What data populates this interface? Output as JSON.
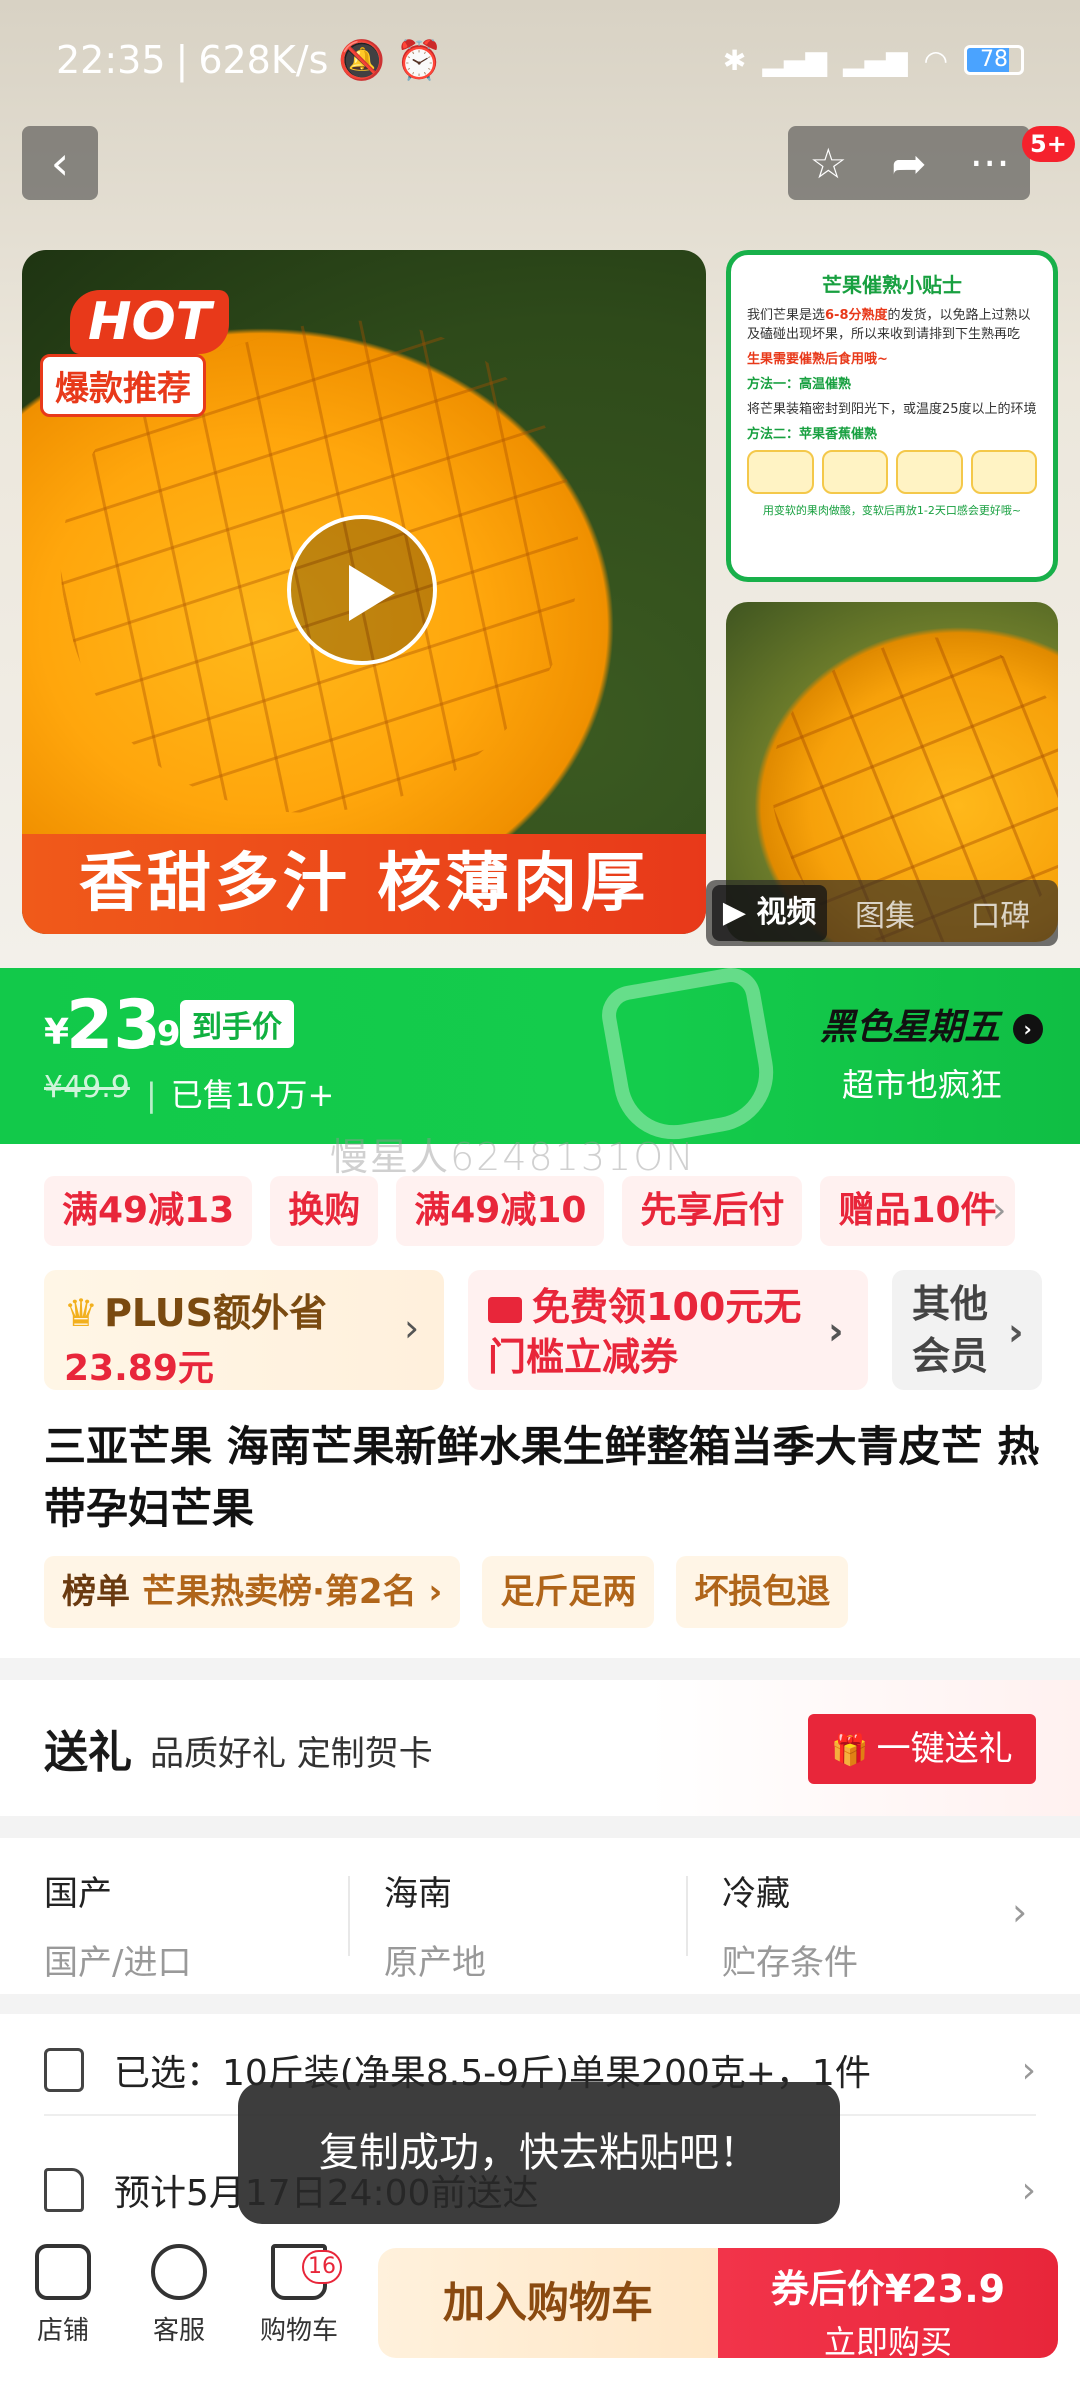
{
  "status_bar": {
    "time": "22:35",
    "speed": "628K/s",
    "battery": "78"
  },
  "nav": {
    "cart_badge": "5+"
  },
  "hero": {
    "hot_label": "HOT",
    "hot_sub": "爆款推荐",
    "slogan": "香甜多汁 核薄肉厚",
    "tips": {
      "title": "芒果催熟小贴士",
      "intro_a": "我们芒果是选",
      "intro_red": "6-8分熟度",
      "intro_b": "的发货，以免路上过熟以及磕碰出现坏果，所以来收到请排到下生熟再吃",
      "note": "生果需要催熟后食用哦~",
      "method1_title": "方法一：高温催熟",
      "method1_text": "将芒果装箱密封到阳光下，或温度25度以上的环境",
      "method2_title": "方法二：苹果香蕉催熟",
      "footer": "用变软的果肉做酸，变软后再放1-2天口感会更好哦~"
    },
    "media_tabs": [
      "视频",
      "图集",
      "口碑"
    ]
  },
  "price": {
    "currency": "¥",
    "integer": "23",
    "decimal": ".9",
    "tag": "到手价",
    "original": "¥49.9",
    "sold": "已售10万+",
    "promo_title": "黑色星期五",
    "promo_sub": "超市也疯狂",
    "watermark": "慢星人6248131ON"
  },
  "coupons": [
    "满49减13",
    "换购",
    "满49减10",
    "先享后付",
    "赠品10件"
  ],
  "members": {
    "plus_title": "PLUS额外省",
    "plus_value": "23.89元",
    "coupon_line1": "免费领100元无",
    "coupon_line2": "门槛立减券",
    "other_line1": "其他",
    "other_line2": "会员"
  },
  "product": {
    "title": "三亚芒果  海南芒果新鲜水果生鲜整箱当季大青皮芒 热带孕妇芒果",
    "rank_label": "榜单",
    "rank_text": "芒果热卖榜·第2名",
    "tags": [
      "足斤足两",
      "坏损包退"
    ]
  },
  "gift": {
    "title": "送礼",
    "subtitle": "品质好礼 定制贺卡",
    "button": "一键送礼"
  },
  "attributes": [
    {
      "value": "国产",
      "key": "国产/进口"
    },
    {
      "value": "海南",
      "key": "原产地"
    },
    {
      "value": "冷藏",
      "key": "贮存条件"
    }
  ],
  "selection": {
    "selected": "已选：10斤装(净果8.5-9斤)单果200克+，1件",
    "delivery": "预计5月17日24:00前送达"
  },
  "toast": "复制成功，快去粘贴吧！",
  "bottom_bar": {
    "shop": "店铺",
    "service": "客服",
    "cart": "购物车",
    "cart_count": "16",
    "add_cart": "加入购物车",
    "buy_price_label": "券后价¥23.9",
    "buy_now": "立即购买"
  }
}
